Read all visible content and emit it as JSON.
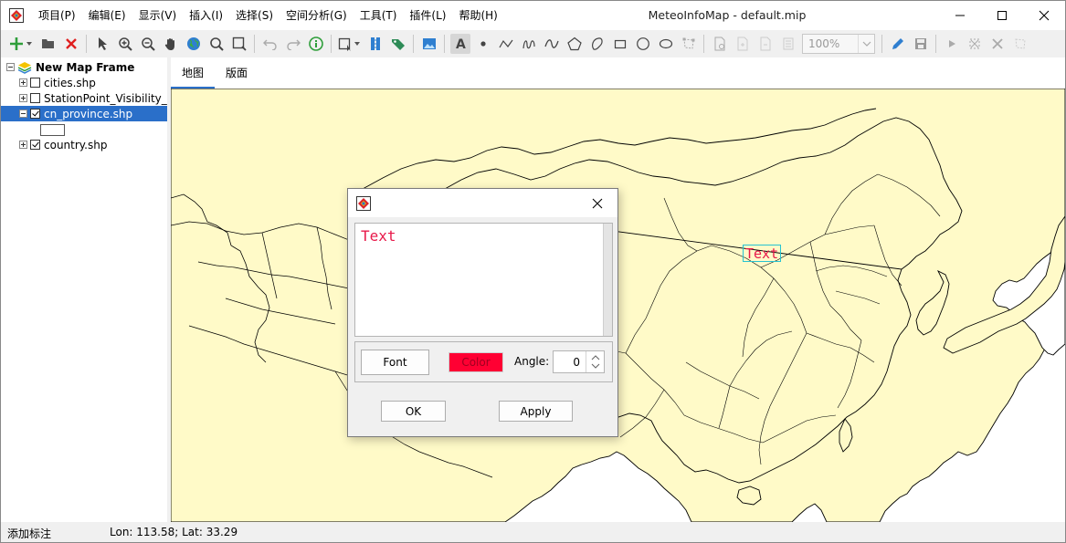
{
  "app": {
    "title": "MeteoInfoMap - default.mip",
    "icon": "meteoinfo-app-icon"
  },
  "menu": [
    {
      "label": "项目(P)"
    },
    {
      "label": "编辑(E)"
    },
    {
      "label": "显示(V)"
    },
    {
      "label": "插入(I)"
    },
    {
      "label": "选择(S)"
    },
    {
      "label": "空间分析(G)"
    },
    {
      "label": "工具(T)"
    },
    {
      "label": "插件(L)"
    },
    {
      "label": "帮助(H)"
    }
  ],
  "toolbar": {
    "zoom_value": "100%",
    "icons": [
      "add-layer-icon",
      "open-folder-icon",
      "remove-layer-icon",
      "select-pointer-icon",
      "zoom-in-icon",
      "zoom-out-icon",
      "pan-hand-icon",
      "full-extent-globe-icon",
      "magnifier-icon",
      "zoom-rectangle-icon",
      "undo-icon",
      "redo-icon",
      "identify-info-icon",
      "selection-tool-icon",
      "measure-icon",
      "label-tag-icon",
      "picture-icon",
      "add-text-icon",
      "add-point-icon",
      "add-polyline-icon",
      "add-freehand-icon",
      "add-curve-icon",
      "add-polygon-icon",
      "add-curve-polygon-icon",
      "add-rectangle-icon",
      "add-circle-icon",
      "add-ellipse-icon",
      "edit-vertices-icon"
    ]
  },
  "layers": {
    "frame": "New Map Frame",
    "items": [
      {
        "name": "cities.shp",
        "checked": false
      },
      {
        "name": "StationPoint_Visibility_",
        "checked": false
      },
      {
        "name": "cn_province.shp",
        "checked": true,
        "selected": true
      },
      {
        "name": "country.shp",
        "checked": true
      }
    ]
  },
  "tabs": [
    {
      "label": "地图",
      "active": true
    },
    {
      "label": "版面",
      "active": false
    }
  ],
  "map": {
    "label_text": "Text",
    "land_color": "#fffac8",
    "text_color": "#e8194a"
  },
  "dialog": {
    "text_value": "Text",
    "font_label": "Font",
    "color_label": "Color",
    "color_value": "#ff0033",
    "angle_label": "Angle:",
    "angle_value": "0",
    "ok_label": "OK",
    "apply_label": "Apply"
  },
  "status": {
    "mode": "添加标注",
    "coords": "Lon: 113.58; Lat: 33.29"
  }
}
